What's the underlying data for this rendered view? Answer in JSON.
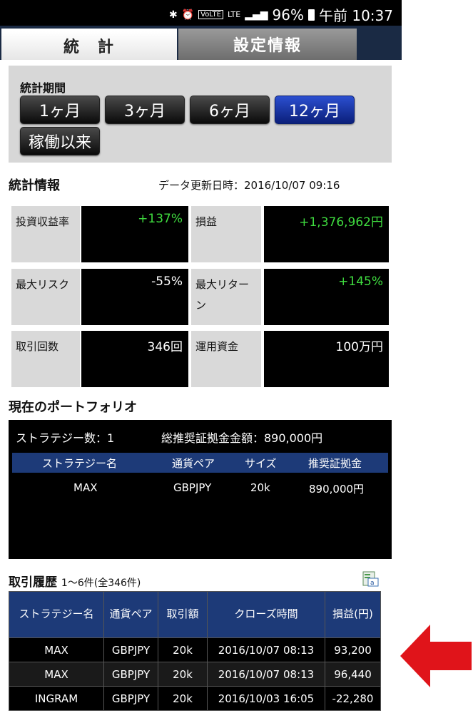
{
  "status_bar": {
    "icons": [
      "bluetooth-icon",
      "alarm-icon",
      "volte-icon",
      "lte-icon",
      "signal-icon"
    ],
    "volte": "VoLTE",
    "lte": "LTE",
    "battery": "96%",
    "time": "午前 10:37"
  },
  "tabs": [
    {
      "label": "統　計",
      "active": true
    },
    {
      "label": "設定情報",
      "active": false
    }
  ],
  "period": {
    "label": "統計期間",
    "buttons": [
      {
        "label": "1ヶ月"
      },
      {
        "label": "3ヶ月"
      },
      {
        "label": "6ヶ月"
      },
      {
        "label": "12ヶ月",
        "active": true
      },
      {
        "label": "稼働以来"
      }
    ]
  },
  "stats": {
    "title": "統計情報",
    "updated": "データ更新日時：2016/10/07 09:16",
    "rows": [
      {
        "label_a": "投資収益率",
        "value_a": "+137%",
        "label_b": "損益",
        "value_b": "+1,376,962円"
      },
      {
        "label_a": "最大リスク",
        "value_a": "-55%",
        "label_b": "最大リターン",
        "value_b": "+145%"
      },
      {
        "label_a": "取引回数",
        "value_a": "346回",
        "label_b": "運用資金",
        "value_b": "100万円"
      }
    ]
  },
  "portfolio": {
    "title": "現在のポートフォリオ",
    "strategy_count": "ストラテジー数：1",
    "total_margin": "総推奨証拠金金額：890,000円",
    "headers": [
      "ストラテジー名",
      "通貨ペア",
      "サイズ",
      "推奨証拠金"
    ],
    "rows": [
      [
        "MAX",
        "GBPJPY",
        "20k",
        "890,000円"
      ]
    ]
  },
  "history": {
    "title": "取引履歴",
    "range": "1～6件(全346件)",
    "headers": [
      "ストラテジー名",
      "通貨ペア",
      "取引額",
      "クローズ時間",
      "損益(円)"
    ],
    "rows": [
      [
        "MAX",
        "GBPJPY",
        "20k",
        "2016/10/07 08:13",
        "93,200"
      ],
      [
        "MAX",
        "GBPJPY",
        "20k",
        "2016/10/07 08:13",
        "96,440"
      ],
      [
        "INGRAM",
        "GBPJPY",
        "20k",
        "2016/10/03 16:05",
        "-22,280"
      ]
    ]
  },
  "colors": {
    "positive": "#3fdc3f",
    "negative": "#ff3030",
    "header_blue": "#1d3a78",
    "active_button": "#1a38a8",
    "annotation_arrow": "#e0141a"
  }
}
